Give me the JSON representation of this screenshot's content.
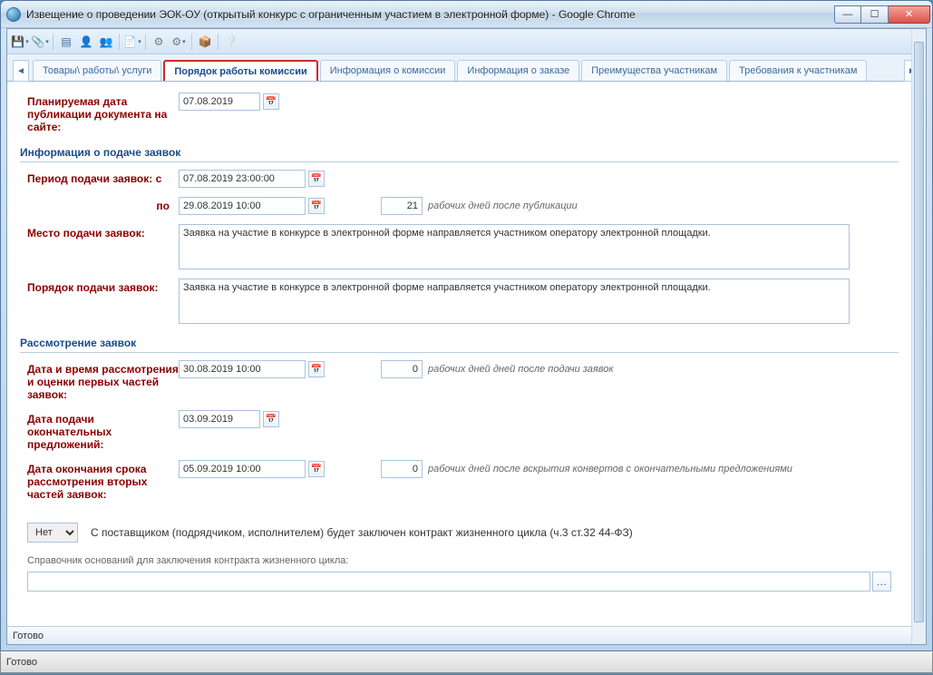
{
  "window": {
    "title": "Извещение о проведении ЭОК-ОУ (открытый конкурс с ограниченным участием в электронной форме) - Google Chrome"
  },
  "tabs": {
    "t0": "Товары\\ работы\\ услуги",
    "t1": "Порядок работы комиссии",
    "t2": "Информация о комиссии",
    "t3": "Информация о заказе",
    "t4": "Преимущества участникам",
    "t5": "Требования к участникам"
  },
  "fields": {
    "planned_pub_label": "Планируемая дата публикации документа на сайте:",
    "planned_pub_value": "07.08.2019",
    "section_submission": "Информация о подаче заявок",
    "period_from_label": "Период подачи заявок: с",
    "period_from_value": "07.08.2019 23:00:00",
    "period_to_label": "по",
    "period_to_value": "29.08.2019 10:00",
    "period_days": "21",
    "period_days_hint": "рабочих дней после публикации",
    "place_label": "Место подачи заявок:",
    "place_value": "Заявка на участие в конкурсе в электронной форме направляется участником оператору электронной площадки.",
    "order_label": "Порядок подачи заявок:",
    "order_value": "Заявка на участие в конкурсе в электронной форме направляется участником оператору электронной площадки.",
    "section_review": "Рассмотрение заявок",
    "review1_label": "Дата и время рассмотрения и оценки первых частей заявок:",
    "review1_value": "30.08.2019 10:00",
    "review1_days": "0",
    "review1_hint": "рабочих дней дней после подачи заявок",
    "final_label": "Дата подачи окончательных предложений:",
    "final_value": "03.09.2019",
    "review2_label": "Дата окончания срока рассмотрения вторых частей заявок:",
    "review2_value": "05.09.2019 10:00",
    "review2_days": "0",
    "review2_hint": "рабочих дней после вскрытия конвертов с окончательными предложениями",
    "contract_sel": "Нет",
    "contract_text": "С поставщиком (подрядчиком, исполнителем) будет заключен контракт жизненного цикла (ч.3 ст.32 44-ФЗ)",
    "grounds_label": "Справочник оснований для заключения контракта жизненного цикла:",
    "grounds_value": ""
  },
  "status": "Готово"
}
